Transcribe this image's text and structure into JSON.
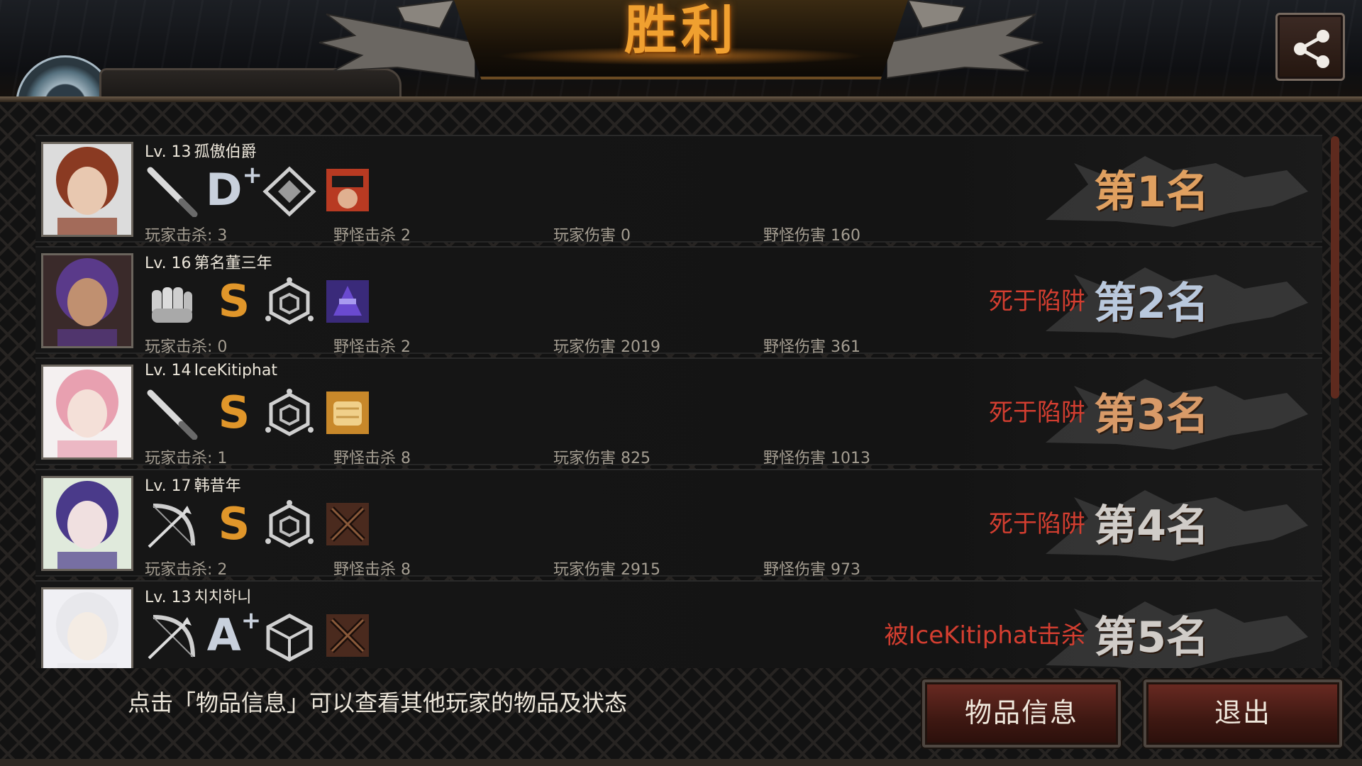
{
  "header": {
    "title": "胜利",
    "share_icon": "share-icon",
    "player_name_partial": "孤傲伯爵"
  },
  "colors": {
    "title_gold": "#f0a030",
    "death_red": "#d33e30",
    "rank1": "#e0a060",
    "rank2": "#b9c8dc",
    "rank3": "#d89a68",
    "rank4": "#d0ccc8",
    "rank5": "#d0ccc8",
    "grade_s": "#e0962a",
    "grade_letter": "#c8d0dc"
  },
  "labels": {
    "player_kills": "玩家击杀",
    "monster_kills": "野怪击杀",
    "player_damage": "玩家伤害",
    "monster_damage": "野怪伤害"
  },
  "players": [
    {
      "lv_prefix": "Lv. 13",
      "name": "孤傲伯爵",
      "weapon": "bat-icon",
      "grade": "D",
      "grade_plus": "+",
      "rank_icon": "diamond-rank-icon",
      "item": "item-goggles-icon",
      "player_kills": "玩家击杀: 3",
      "monster_kills": "野怪击杀 2",
      "player_damage": "玩家伤害 0",
      "monster_damage": "野怪伤害 160",
      "death": "",
      "rank": "第1名"
    },
    {
      "lv_prefix": "Lv. 16",
      "name": "第名董三年",
      "weapon": "fist-icon",
      "grade": "S",
      "grade_plus": "",
      "rank_icon": "hexagon-rank-icon",
      "item": "item-purple-icon",
      "player_kills": "玩家击杀: 0",
      "monster_kills": "野怪击杀 2",
      "player_damage": "玩家伤害 2019",
      "monster_damage": "野怪伤害 361",
      "death": "死于陷阱",
      "rank": "第2名"
    },
    {
      "lv_prefix": "Lv. 14",
      "name": "IceKitiphat",
      "weapon": "bat-icon",
      "grade": "S",
      "grade_plus": "",
      "rank_icon": "hexagon-rank-icon",
      "item": "item-bread-icon",
      "player_kills": "玩家击杀: 1",
      "monster_kills": "野怪击杀 8",
      "player_damage": "玩家伤害 825",
      "monster_damage": "野怪伤害 1013",
      "death": "死于陷阱",
      "rank": "第3名"
    },
    {
      "lv_prefix": "Lv. 17",
      "name": "韩昔年",
      "weapon": "bow-icon",
      "grade": "S",
      "grade_plus": "",
      "rank_icon": "hexagon-rank-icon",
      "item": "item-crossed-icon",
      "player_kills": "玩家击杀: 2",
      "monster_kills": "野怪击杀 8",
      "player_damage": "玩家伤害 2915",
      "monster_damage": "野怪伤害 973",
      "death": "死于陷阱",
      "rank": "第4名"
    },
    {
      "lv_prefix": "Lv. 13",
      "name": "치치하니",
      "weapon": "bow-icon",
      "grade": "A",
      "grade_plus": "+",
      "rank_icon": "cube-rank-icon",
      "item": "item-crossed-icon",
      "player_kills": "",
      "monster_kills": "",
      "player_damage": "",
      "monster_damage": "",
      "death": "被IceKitiphat击杀",
      "rank": "第5名"
    }
  ],
  "footer": {
    "hint": "点击「物品信息」可以查看其他玩家的物品及状态",
    "item_info_button": "物品信息",
    "exit_button": "退出"
  }
}
